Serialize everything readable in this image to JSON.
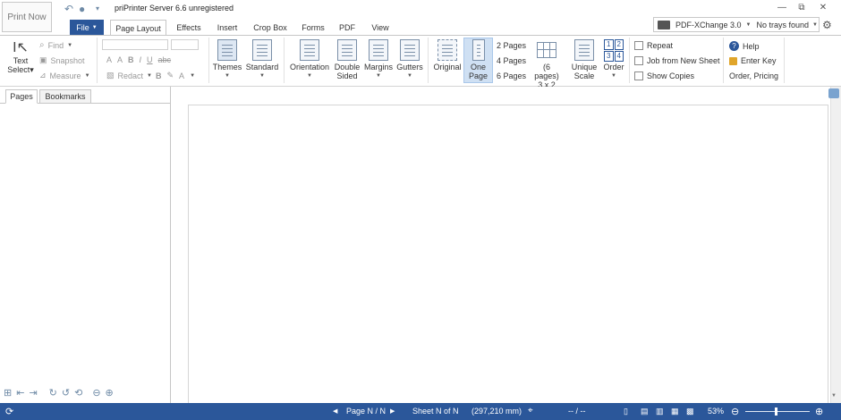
{
  "titlebar": {
    "print_now": "Print Now",
    "title": "priPrinter Server 6.6 unregistered",
    "minimize": "—",
    "restore": "⧉",
    "close": "✕"
  },
  "tabs": {
    "file": "File",
    "items": [
      "Page Layout",
      "Effects",
      "Insert",
      "Crop Box",
      "Forms",
      "PDF",
      "View"
    ]
  },
  "printer": {
    "name": "PDF-XChange 3.0",
    "trays": "No trays found"
  },
  "ribbon": {
    "text_select": "Text\nSelect",
    "find": "Find",
    "snapshot": "Snapshot",
    "measure": "Measure",
    "redact": "Redact",
    "font_b": "B",
    "font_i": "I",
    "font_u": "U",
    "font_s": "abc",
    "font_a_up": "A",
    "font_a_down": "A",
    "font_a": "A",
    "themes": "Themes",
    "standard": "Standard",
    "orientation": "Orientation",
    "double_sided_1": "Double",
    "double_sided_2": "Sided",
    "margins": "Margins",
    "gutters": "Gutters",
    "original": "Original",
    "one_page_1": "One",
    "one_page_2": "Page",
    "pages_2": "2 Pages",
    "pages_4": "4 Pages",
    "pages_6": "6 Pages",
    "grid_label": "(6 pages)",
    "grid_size": "3 x 2",
    "unique_scale_1": "Unique",
    "unique_scale_2": "Scale",
    "order": "Order",
    "order_digits": [
      "1",
      "2",
      "3",
      "4"
    ],
    "repeat": "Repeat",
    "job_from_new_sheet": "Job from New Sheet",
    "show_copies": "Show Copies",
    "help": "Help",
    "enter_key": "Enter Key",
    "order_pricing": "Order, Pricing"
  },
  "panel": {
    "tab_pages": "Pages",
    "tab_bookmarks": "Bookmarks"
  },
  "status": {
    "page": "Page N / N",
    "sheet": "Sheet N of N",
    "size": "(297,210 mm)",
    "coords": "-- / --",
    "zoom": "53%"
  },
  "colors": {
    "accent": "#2b579a",
    "highlight": "#cfe0f3"
  }
}
